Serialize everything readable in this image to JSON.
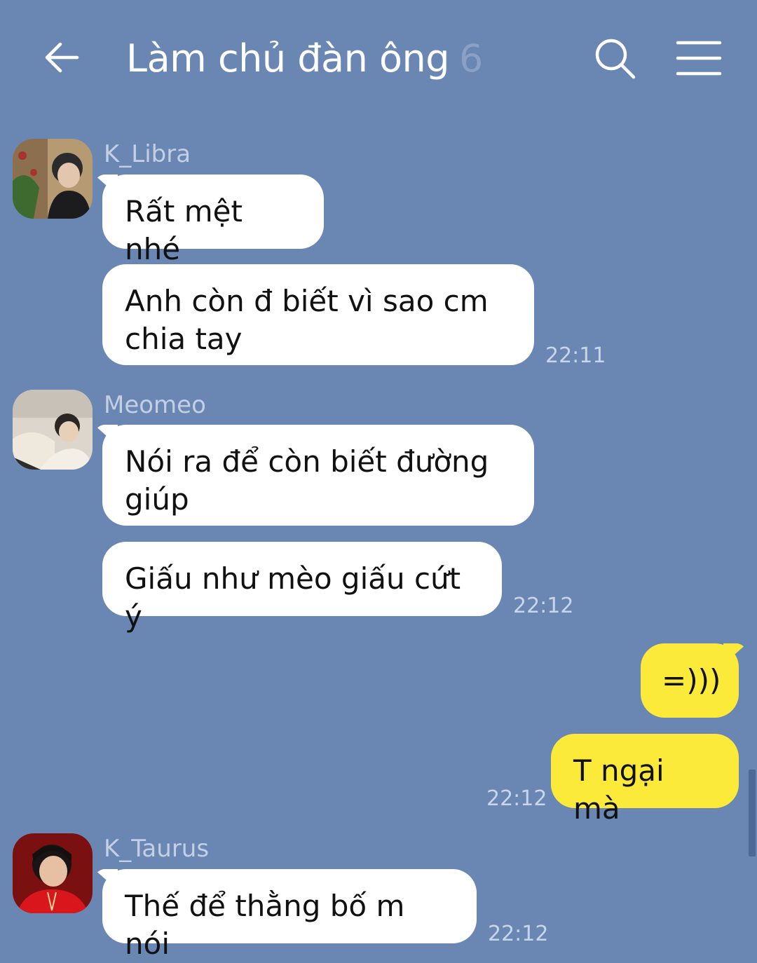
{
  "header": {
    "title": "Làm chủ đàn ông",
    "member_count": "6",
    "back_icon": "back-arrow-icon",
    "search_icon": "search-icon",
    "menu_icon": "hamburger-menu-icon"
  },
  "colors": {
    "background": "#6a86b3",
    "incoming_bubble": "#ffffff",
    "outgoing_bubble": "#fcea3a"
  },
  "messages": [
    {
      "sender": "K_Libra",
      "bubbles": [
        "Rất mệt nhé",
        "Anh còn đ biết vì sao cm chia tay"
      ],
      "time": "22:11"
    },
    {
      "sender": "Meomeo",
      "bubbles": [
        "Nói ra để còn biết đường giúp",
        "Giấu như mèo giấu cứt ý"
      ],
      "time": "22:12"
    },
    {
      "sender": "me",
      "bubbles": [
        "=)))",
        "T ngại mà"
      ],
      "time": "22:12"
    },
    {
      "sender": "K_Taurus",
      "bubbles": [
        "Thế để thằng bố m nói"
      ],
      "time": "22:12"
    }
  ]
}
